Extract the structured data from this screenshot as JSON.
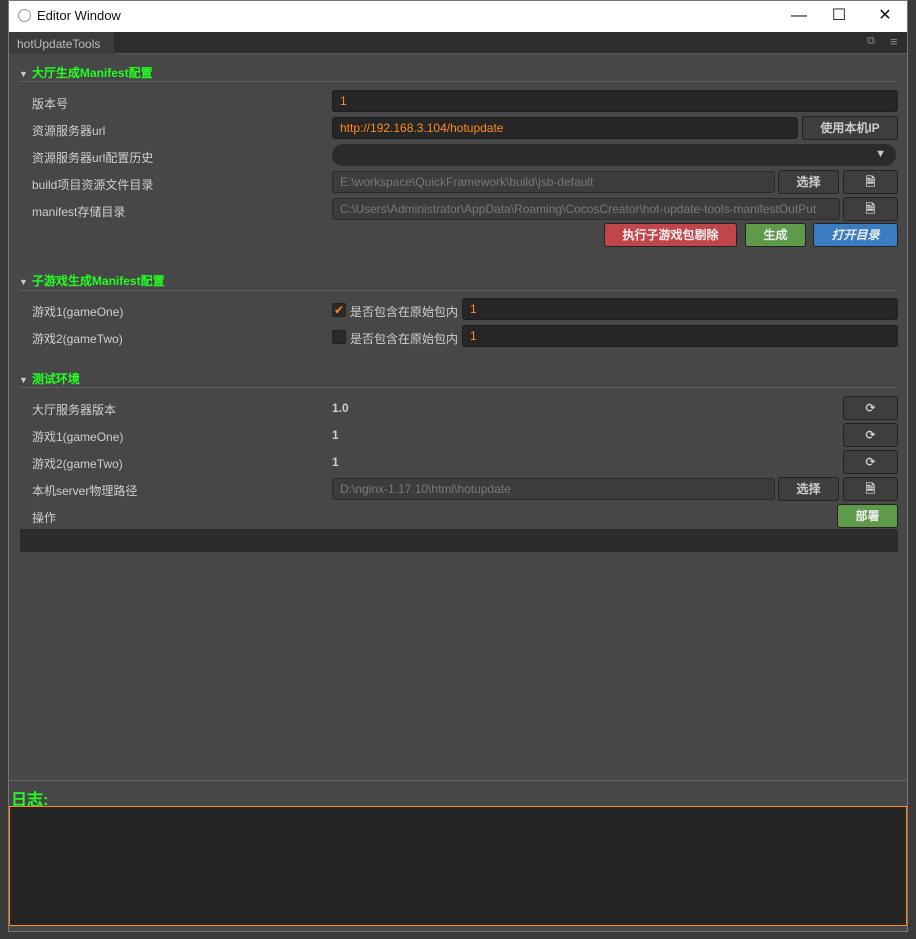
{
  "window": {
    "title": "Editor Window",
    "minimize": "—",
    "maximize": "☐",
    "close": "✕"
  },
  "tab": {
    "label": "hotUpdateTools"
  },
  "hall": {
    "header": "大厅生成Manifest配置",
    "version_label": "版本号",
    "version_value": "1",
    "url_label": "资源服务器url",
    "url_value": "http://192.168.3.104/hotupdate",
    "use_local_ip": "使用本机IP",
    "history_label": "资源服务器url配置历史",
    "build_label": "build项目资源文件目录",
    "build_value": "E:\\workspace\\QuickFramework\\build\\jsb-default",
    "select": "选择",
    "manifest_label": "manifest存储目录",
    "manifest_value": "C:\\Users\\Administrator\\AppData\\Roaming\\CocosCreator\\hot-update-tools-manifestOutPut",
    "remove_sub": "执行子游戏包剔除",
    "generate": "生成",
    "open_dir": "打开目录"
  },
  "sub": {
    "header": "子游戏生成Manifest配置",
    "games": [
      {
        "label": "游戏1(gameOne)",
        "include_label": "是否包含在原始包内",
        "checked": true,
        "version": "1"
      },
      {
        "label": "游戏2(gameTwo)",
        "include_label": "是否包含在原始包内",
        "checked": false,
        "version": "1"
      }
    ]
  },
  "test": {
    "header": "测试环境",
    "rows": [
      {
        "label": "大厅服务器版本",
        "value": "1.0"
      },
      {
        "label": "游戏1(gameOne)",
        "value": "1"
      },
      {
        "label": "游戏2(gameTwo)",
        "value": "1"
      }
    ],
    "server_label": "本机server物理路径",
    "server_value": "D:\\nginx-1.17.10\\html\\hotupdate",
    "select": "选择",
    "op_label": "操作",
    "deploy": "部署"
  },
  "log": {
    "label": "日志:"
  },
  "colors": {
    "green": "#22ff22",
    "orange": "#ff8a1e",
    "red": "#c1464c",
    "okgreen": "#5f9a4a",
    "blue": "#3b7cc0"
  }
}
